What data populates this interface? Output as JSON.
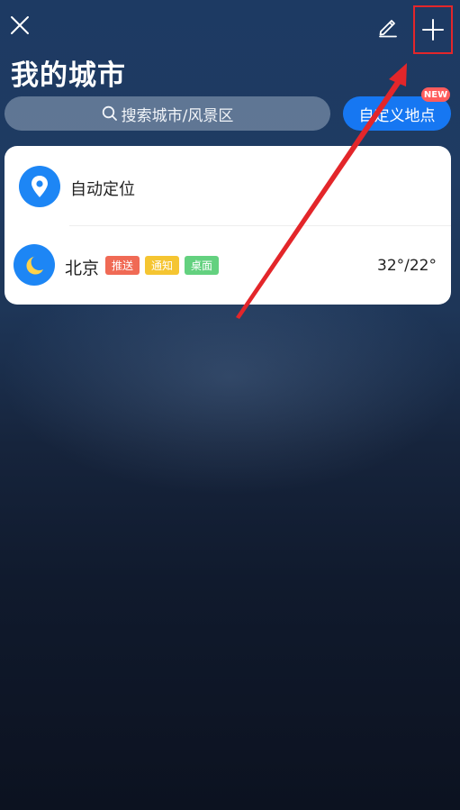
{
  "header": {
    "title": "我的城市"
  },
  "search": {
    "placeholder": "搜索城市/风景区"
  },
  "custom_location": {
    "label": "自定义地点",
    "badge": "NEW"
  },
  "auto_location": {
    "label": "自动定位"
  },
  "cities": [
    {
      "name": "北京",
      "tags": [
        "推送",
        "通知",
        "桌面"
      ],
      "temperature": "32°/22°"
    }
  ],
  "colors": {
    "accent": "#1677f2",
    "highlight_box": "#e3262a",
    "tag_push": "#f06a55",
    "tag_notify": "#f5c531",
    "tag_desk": "#63d17f"
  },
  "icons": {
    "close": "close-icon",
    "edit": "pencil-icon",
    "add": "plus-icon",
    "search": "search-icon",
    "location": "location-pin-icon",
    "weather": "moon-icon"
  }
}
